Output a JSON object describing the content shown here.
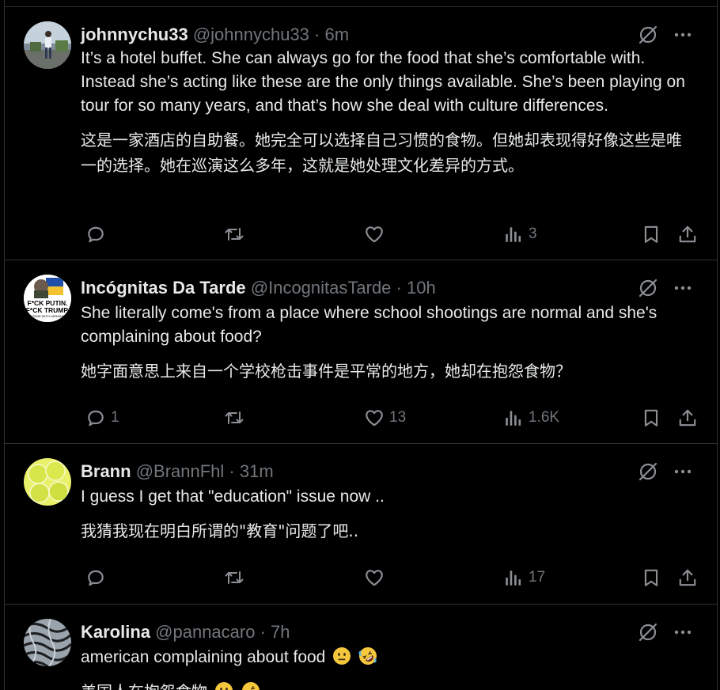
{
  "colors": {
    "background": "#000000",
    "text": "#e7e9ea",
    "muted": "#71767b",
    "divider": "#2f3336"
  },
  "tweets": [
    {
      "name": "johnnychu33",
      "handle": "@johnnychu33",
      "time": "6m",
      "text": "It’s a hotel buffet. She can always go for the food that she’s comfortable with. Instead she’s acting like these are the only things available. She’s been playing on tour for so many years, and that’s how she deal with culture differences.",
      "translation": "这是一家酒店的自助餐。她完全可以选择自己习惯的食物。但她却表现得好像这些是唯一的选择。她在巡演这么多年，这就是她处理文化差异的方式。",
      "replies": "",
      "reposts": "",
      "likes": "",
      "views": "3"
    },
    {
      "name": "Incógnitas Da Tarde",
      "handle": "@IncognitasTarde",
      "time": "10h",
      "text": "She literally come's from a place where school shootings are normal and she's complaining about food?",
      "translation": "她字面意思上来自一个学校枪击事件是平常的地方，她却在抱怨食物？",
      "replies": "1",
      "reposts": "",
      "likes": "13",
      "views": "1.6K",
      "avatar_text": [
        "F*CK PUTIN.",
        "F*CK TRUMP.",
        "STAND WITH UKRAINE"
      ]
    },
    {
      "name": "Brann",
      "handle": "@BrannFhl",
      "time": "31m",
      "text": "I guess I get that \"education\" issue now ..",
      "translation": "我猜我现在明白所谓的\"教育\"问题了吧..",
      "replies": "",
      "reposts": "",
      "likes": "",
      "views": "17"
    },
    {
      "name": "Karolina",
      "handle": "@pannacaro",
      "time": "7h",
      "text": "american complaining about food",
      "translation": "美国人在抱怨食物",
      "emojis": [
        "neutral-face",
        "rolling-on-floor-laughing"
      ]
    }
  ]
}
